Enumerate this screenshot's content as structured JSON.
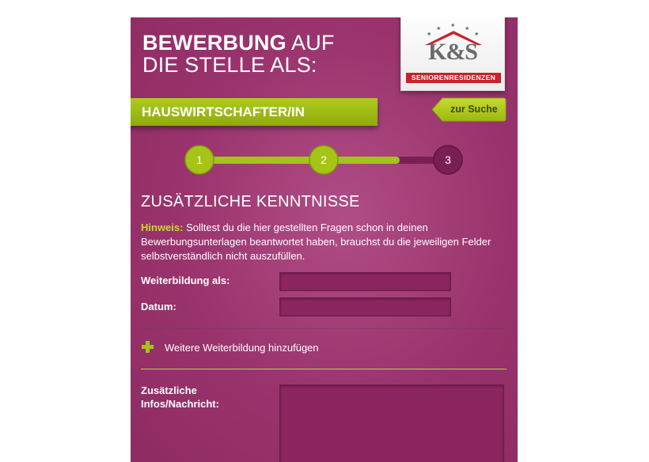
{
  "header": {
    "title_bold": "BEWERBUNG",
    "title_rest_1": "AUF",
    "title_line_2": "DIE STELLE ALS:"
  },
  "logo": {
    "mark": "K&S",
    "tagline": "SENIORENRESIDENZEN",
    "brand_color": "#c8232c"
  },
  "job": {
    "title": "HAUSWIRTSCHAFTER/IN"
  },
  "back_button": {
    "label": "zur Suche"
  },
  "steps": {
    "items": [
      "1",
      "2",
      "3"
    ],
    "current": 2,
    "progress_fraction": 0.8,
    "active_color": "#a6c418",
    "inactive_color": "#7a1f53"
  },
  "section": {
    "title": "ZUSÄTZLICHE KENNTNISSE",
    "hint_label": "Hinweis:",
    "hint_text": " Solltest du die hier gestellten Fragen schon in deinen Bewerbungsunterlagen beantwortet haben, brauchst du die jeweiligen Felder selbstverständlich nicht auszufüllen."
  },
  "fields": {
    "weiterbildung_label": "Weiterbildung als:",
    "weiterbildung_value": "",
    "datum_label": "Datum:",
    "datum_value": "",
    "add_label": "Weitere Weiterbildung hinzufügen",
    "info_label_1": "Zusätzliche",
    "info_label_2": "Infos/Nachricht:",
    "info_value": ""
  },
  "colors": {
    "panel": "#9a336d",
    "accent": "#a6c418",
    "hint_label": "#c5db2a"
  }
}
